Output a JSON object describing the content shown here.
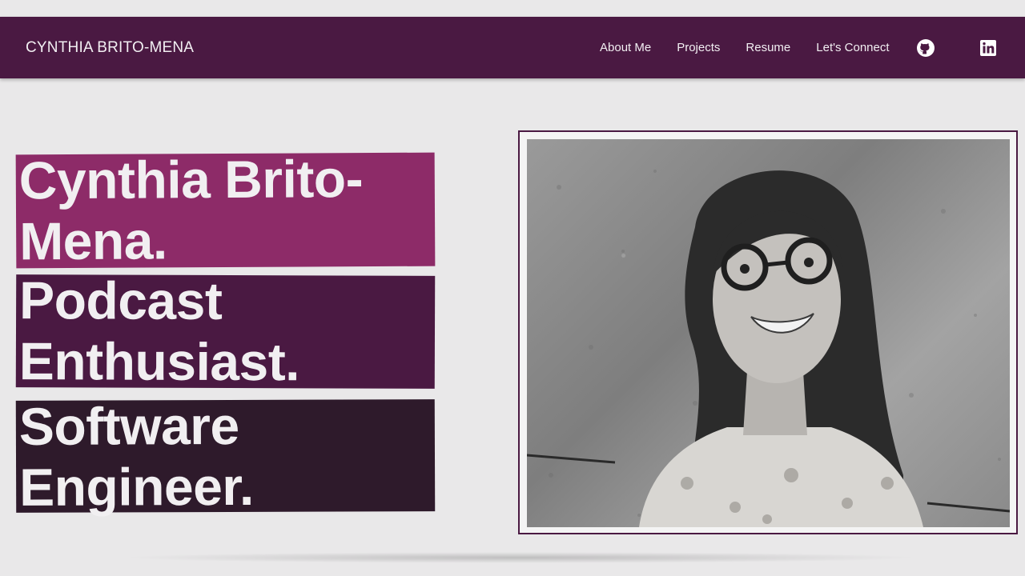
{
  "navbar": {
    "brand": "CYNTHIA BRITO-MENA",
    "links": [
      "About Me",
      "Projects",
      "Resume",
      "Let's Connect"
    ],
    "social": [
      "github-icon",
      "linkedin-icon"
    ],
    "background": "#4a1942"
  },
  "hero": {
    "lines": [
      {
        "line1": "Cynthia Brito-",
        "line2": "Mena.",
        "color": "#8d2b68"
      },
      {
        "line1": "Podcast",
        "line2": "Enthusiast.",
        "color": "#4a1942"
      },
      {
        "line1": "Software",
        "line2": "Engineer.",
        "color": "#2e1a2b"
      }
    ]
  },
  "photo": {
    "description_icon": "portrait-photo"
  }
}
